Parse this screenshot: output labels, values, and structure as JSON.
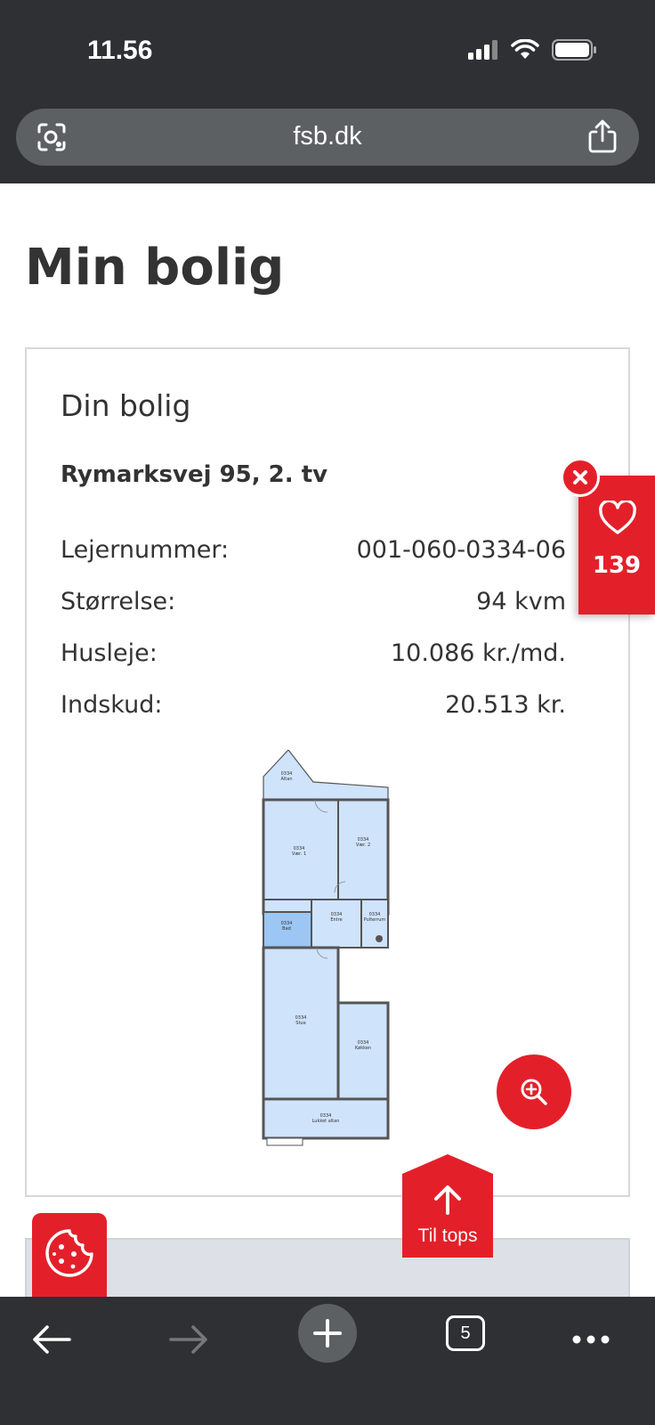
{
  "status_bar": {
    "time": "11.56"
  },
  "browser": {
    "url": "fsb.dk",
    "open_tabs": "5"
  },
  "page": {
    "title": "Min bolig"
  },
  "card": {
    "title": "Din bolig",
    "address": "Rymarksvej 95, 2. tv",
    "rows": [
      {
        "label": "Lejernummer:",
        "value": "001-060-0334-06"
      },
      {
        "label": "Størrelse:",
        "value": "94 kvm"
      },
      {
        "label": "Husleje:",
        "value": "10.086 kr./md."
      },
      {
        "label": "Indskud:",
        "value": "20.513 kr."
      }
    ]
  },
  "floorplan": {
    "rooms": [
      {
        "id": "0334",
        "name": "Altan"
      },
      {
        "id": "0334",
        "name": "Vær. 1"
      },
      {
        "id": "0334",
        "name": "Vær. 2"
      },
      {
        "id": "0334",
        "name": "Bad"
      },
      {
        "id": "0334",
        "name": "Entre"
      },
      {
        "id": "0334",
        "name": "Pulterrum"
      },
      {
        "id": "0334",
        "name": "Stue"
      },
      {
        "id": "0334",
        "name": "Køkken"
      },
      {
        "id": "0334",
        "name": "Lukket altan"
      }
    ]
  },
  "favorite": {
    "count": "139"
  },
  "to_top": {
    "label": "Til tops"
  },
  "colors": {
    "brand_red": "#e3202a",
    "chrome_dark": "#2e3033",
    "plan_blue": "#cfe3fb"
  },
  "icons": [
    "camera-search-icon",
    "share-icon",
    "heart-icon",
    "close-icon",
    "zoom-in-icon",
    "arrow-up-icon",
    "cookie-icon",
    "back-icon",
    "forward-icon",
    "plus-icon"
  ]
}
